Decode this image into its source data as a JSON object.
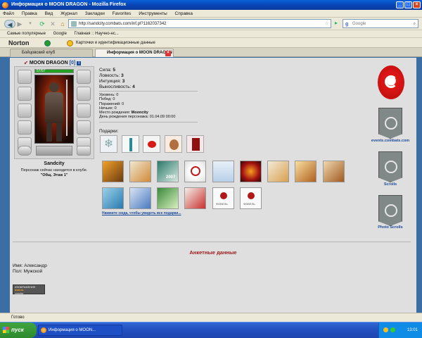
{
  "window": {
    "title": "Информация о MOON DRAGON - Mozilla Firefox"
  },
  "menu": [
    "Файл",
    "Правка",
    "Вид",
    "Журнал",
    "Закладки",
    "Favorites",
    "Инструменты",
    "Справка"
  ],
  "nav": {
    "url": "http://sandcity.combats.com/inf.pl?1162037342",
    "search_placeholder": "Google"
  },
  "bookmarks": [
    "Самые популярные",
    "Google",
    "Главная :: Научно-нс..."
  ],
  "norton": {
    "brand": "Norton",
    "item": "Карточки и идентификационные данные"
  },
  "tabs": [
    {
      "label": "Бойцовский клуб",
      "active": false
    },
    {
      "label": "Информация о MOON DRAGON",
      "active": true
    }
  ],
  "character": {
    "name": "MOON DRAGON",
    "level": "[0]",
    "hp": "57/57",
    "city": "Sandcity",
    "location_note": "Персонаж сейчас находится в клубе.",
    "room": "\"Общ. Этаж 1\""
  },
  "stats": [
    {
      "label": "Сила:",
      "value": "5"
    },
    {
      "label": "Ловкость:",
      "value": "3"
    },
    {
      "label": "Интуиция:",
      "value": "3"
    },
    {
      "label": "Выносливость:",
      "value": "4"
    }
  ],
  "info": [
    {
      "label": "Уровень:",
      "value": "0"
    },
    {
      "label": "Побед:",
      "value": "0"
    },
    {
      "label": "Поражений:",
      "value": "0"
    },
    {
      "label": "Ничьих:",
      "value": "0"
    },
    {
      "label": "Место рождения:",
      "value": "Mooncity"
    },
    {
      "label": "День рождения персонажа:",
      "value": "01.04.09 00:00"
    }
  ],
  "gifts_label": "Подарки:",
  "gifts": [
    "snowflake-gift",
    "lighthouse-gift",
    "heart-box-gift",
    "teddy-bear-gift",
    "book-gift"
  ],
  "cards_row1": [
    "card-1",
    "card-2",
    "card-3",
    "card-4",
    "card-5",
    "card-6",
    "card-7",
    "card-8",
    "card-9"
  ],
  "cards_row2": [
    "card-10",
    "card-11",
    "card-12",
    "card-13",
    "card-14",
    "card-15"
  ],
  "card_texts": {
    "c3": "2007",
    "c14": "ФОВЕЛЬ",
    "c15": "ФОВЕЛЬ"
  },
  "all_gifts_link": "Нажмите сюда, чтобы увидеть все подарки...",
  "side_links": [
    "events.combats.com",
    "Scrolls",
    "Photo Scrolls"
  ],
  "profile": {
    "heading": "Анкетные данные",
    "name_label": "Имя:",
    "name_value": "Александр",
    "gender_label": "Пол:",
    "gender_value": "Мужской"
  },
  "counter": {
    "line1": "ИЗОБРАЖЕНИЕ",
    "line2": "mail.ru",
    "line3": "counter"
  },
  "status": {
    "text": "Готово"
  },
  "taskbar": {
    "start": "пуск",
    "item": "Информация о MOON...",
    "time": "13:01"
  },
  "colors": {
    "accent_red": "#a01c1c",
    "link_blue": "#1a4a9a",
    "hp_green": "#21a021"
  }
}
